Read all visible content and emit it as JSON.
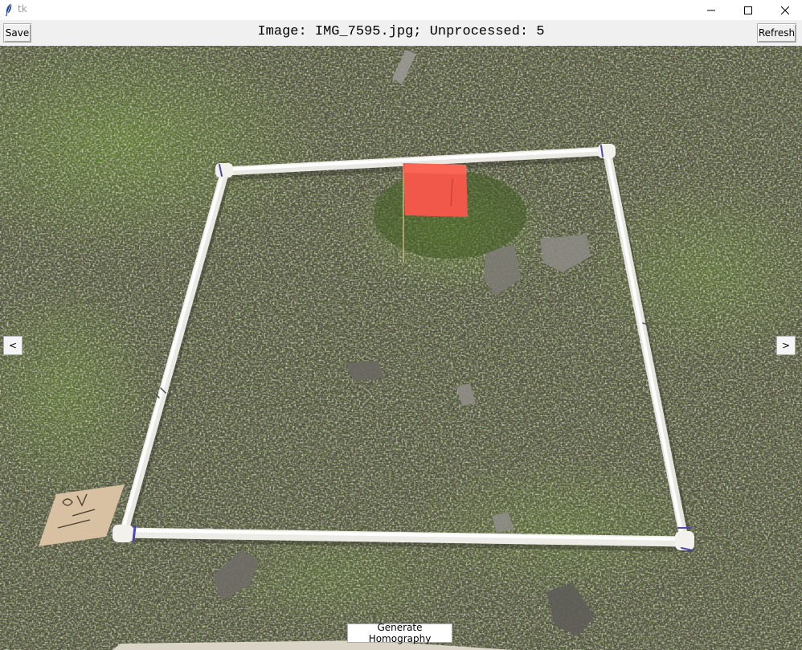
{
  "window": {
    "title": "tk",
    "controls": {
      "minimize": "minimize-icon",
      "maximize": "maximize-icon",
      "close": "close-icon"
    }
  },
  "toolbar": {
    "save_label": "Save",
    "status_text": "Image: IMG_7595.jpg; Unprocessed: 5",
    "refresh_label": "Refresh"
  },
  "navigation": {
    "prev_label": "<",
    "next_label": ">"
  },
  "actions": {
    "generate_label": "Generate Homography"
  },
  "colors": {
    "quadrat_pipe": "#f4f4f2",
    "flag": "#f2584a",
    "ground": "#4b4a3a",
    "grass": "#5c7a2c",
    "lichen": "#b8b6a6"
  }
}
